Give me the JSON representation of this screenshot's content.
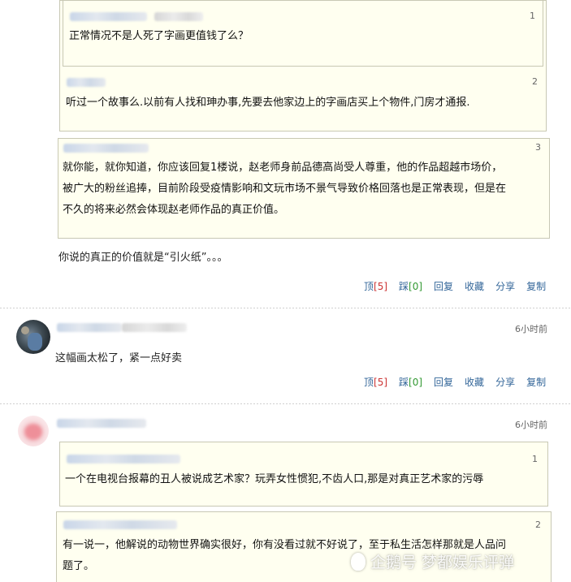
{
  "thread1": {
    "quotes": [
      {
        "num": "1",
        "text": "正常情况不是人死了字画更值钱了么？"
      },
      {
        "num": "2",
        "text": "听过一个故事么.以前有人找和珅办事,先要去他家边上的字画店买上个物件,门房才通报."
      },
      {
        "num": "3",
        "line1": "就你能，就你知道，你应该回复1楼说，赵老师身前品德高尚受人尊重，他的作品超越市场价，",
        "line2": "被广大的粉丝追捧，目前阶段受疫情影响和文玩市场不景气导致价格回落也是正常表现，但是在",
        "line3": "不久的将来必然会体现赵老师作品的真正价值。"
      }
    ],
    "reply": "你说的真正的价值就是“引火纸”。。。",
    "actions": {
      "top": "顶",
      "top_count": "[5]",
      "step": "踩",
      "step_count": "[0]",
      "reply": "回复",
      "collect": "收藏",
      "share": "分享",
      "copy": "复制"
    }
  },
  "thread2": {
    "time": "6小时前",
    "text": "这幅画太松了，紧一点好卖",
    "actions": {
      "top": "顶",
      "top_count": "[5]",
      "step": "踩",
      "step_count": "[0]",
      "reply": "回复",
      "collect": "收藏",
      "share": "分享",
      "copy": "复制"
    }
  },
  "thread3": {
    "time": "6小时前",
    "quotes": [
      {
        "num": "1",
        "text": "一个在电视台报幕的丑人被说成艺术家？玩弄女性惯犯,不齿人口,那是对真正艺术家的污辱"
      },
      {
        "num": "2",
        "line1": "有一说一，他解说的动物世界确实很好，你有没看过就不好说了，至于私生活怎样那就是人品问",
        "line2": "题了。"
      }
    ]
  },
  "watermark": "企鹅号 梦都娱乐评弹"
}
